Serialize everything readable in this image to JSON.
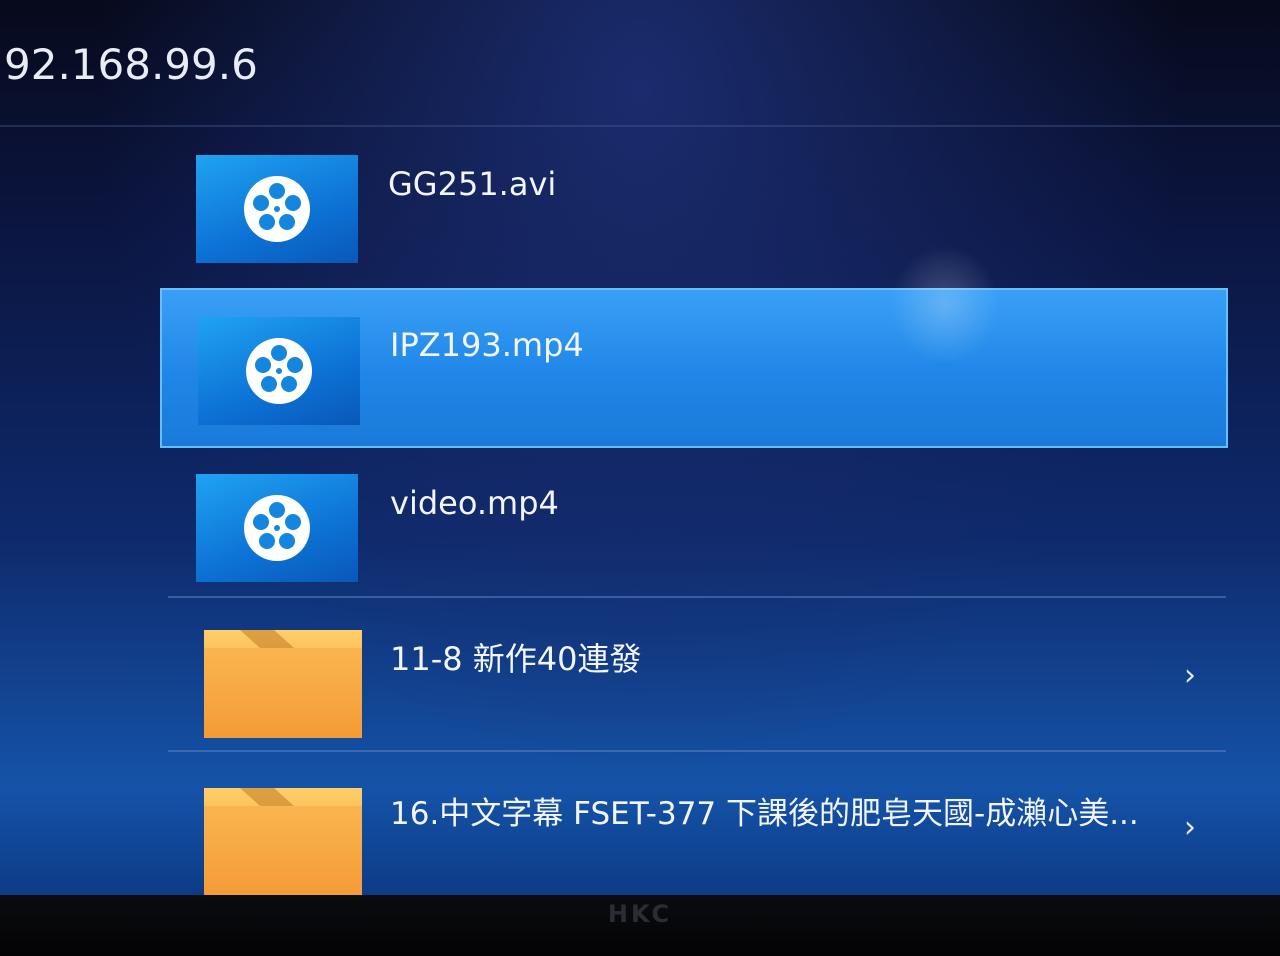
{
  "header": {
    "path": "92.168.99.6"
  },
  "files": [
    {
      "name": "GG251.avi",
      "type": "video",
      "icon": "film-reel-icon",
      "selected": false
    },
    {
      "name": "IPZ193.mp4",
      "type": "video",
      "icon": "film-reel-icon",
      "selected": true
    },
    {
      "name": "video.mp4",
      "type": "video",
      "icon": "film-reel-icon",
      "selected": false
    },
    {
      "name": "11-8 新作40連發",
      "type": "folder",
      "icon": "folder-icon",
      "selected": false
    },
    {
      "name": "16.中文字幕 FSET-377 下課後的肥皂天國-成瀨心美...",
      "type": "folder",
      "icon": "folder-icon",
      "selected": false
    }
  ],
  "chevron": "›",
  "bezel": {
    "brand": "HKC"
  },
  "colors": {
    "selection": "#2590ee",
    "video_thumb": "#1288e0",
    "folder": "#f3a53c"
  }
}
